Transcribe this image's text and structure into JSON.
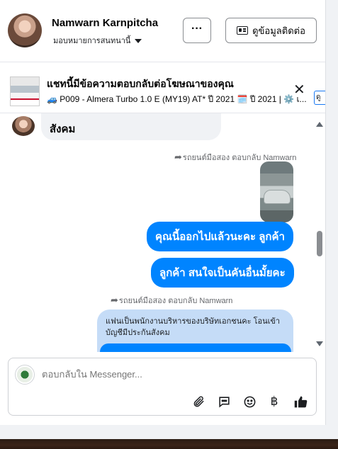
{
  "header": {
    "name": "Namwarn Karnpitcha",
    "subtitle": "มอบหมายการสนทนานี้",
    "more_label": "···",
    "contact_label": "ดูข้อมูลติดต่อ"
  },
  "ad": {
    "title": "แชทนี้มีข้อความตอบกลับต่อโฆษณาของคุณ",
    "subtitle": "🚙 P009 - Almera Turbo 1.0 E (MY19) AT* ปี 2021 🗓️ ปี 2021 | ⚙️ เ...",
    "close_label": "✕",
    "badge_text": "ดู"
  },
  "messages": {
    "incoming_text": "สังคม",
    "reply_meta_1": "รถยนต์มือสอง ตอบกลับ Namwarn",
    "out_1": "คุณนี้ออกไปแล้วนะคะ  ลูกค้า",
    "out_2": "ลูกค้า สนใจเป็นคันอื่นมั้ยคะ",
    "reply_meta_2": "รถยนต์มือสอง ตอบกลับ Namwarn",
    "quoted_text": "แฟนเป็นพนักงานบริหารของบริษัทเอกชนคะ โอนเข้าบัญชีมีประกันสังคม"
  },
  "composer": {
    "placeholder": "ตอบกลับใน Messenger...",
    "tools": [
      "paperclip-icon",
      "chat-bubble-icon",
      "emoji-icon",
      "baht-icon",
      "thumbs-up-icon"
    ]
  },
  "colors": {
    "accent": "#0084ff",
    "light_bubble": "#c5dcf7",
    "incoming_bubble": "#f0f2f5"
  }
}
